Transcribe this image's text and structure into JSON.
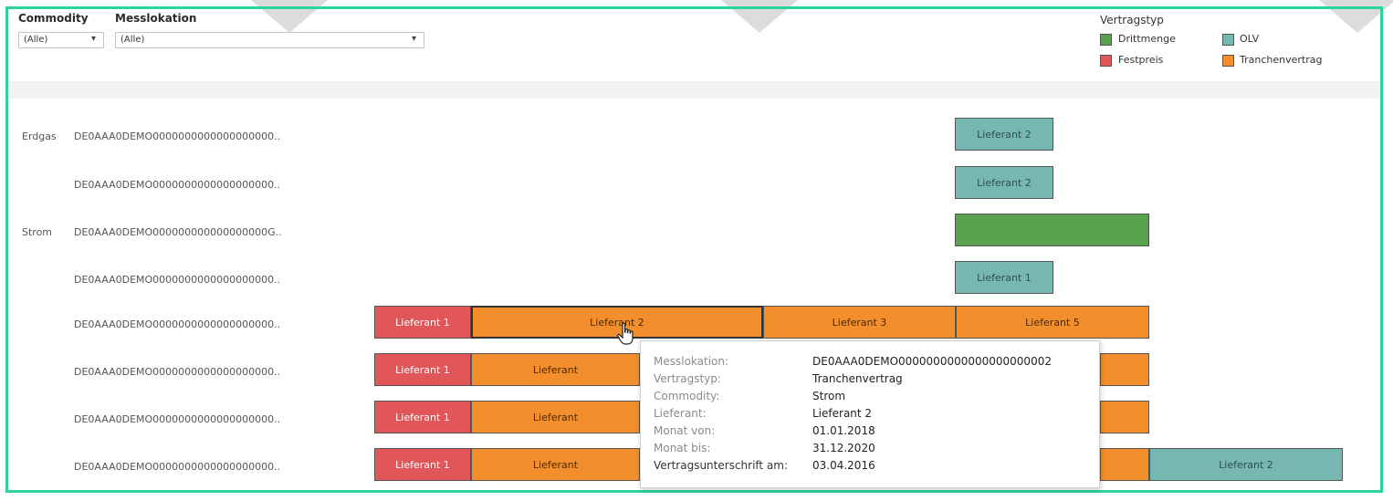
{
  "filters": {
    "commodity": {
      "label": "Commodity",
      "value": "(Alle)"
    },
    "messlokation": {
      "label": "Messlokation",
      "value": "(Alle)"
    }
  },
  "legend": {
    "title": "Vertragstyp",
    "items": [
      {
        "label": "Drittmenge",
        "color": "#59a14f"
      },
      {
        "label": "OLV",
        "color": "#76b7b2"
      },
      {
        "label": "Festpreis",
        "color": "#e15759"
      },
      {
        "label": "Tranchenvertrag",
        "color": "#f28e2b"
      }
    ]
  },
  "rows": [
    {
      "commodity": "Erdgas",
      "messlokation": "DE0AAA0DEMO0000000000000000000.."
    },
    {
      "commodity": "",
      "messlokation": "DE0AAA0DEMO0000000000000000000.."
    },
    {
      "commodity": "Strom",
      "messlokation": "DE0AAA0DEMO000000000000000000G.."
    },
    {
      "commodity": "",
      "messlokation": "DE0AAA0DEMO0000000000000000000.."
    },
    {
      "commodity": "",
      "messlokation": "DE0AAA0DEMO0000000000000000000.."
    },
    {
      "commodity": "",
      "messlokation": "DE0AAA0DEMO0000000000000000000.."
    },
    {
      "commodity": "",
      "messlokation": "DE0AAA0DEMO0000000000000000000.."
    },
    {
      "commodity": "",
      "messlokation": "DE0AAA0DEMO0000000000000000000.."
    }
  ],
  "chart_data": {
    "type": "gantt",
    "bars": [
      {
        "row": 0,
        "label": "Lieferant 2",
        "type": "OLV"
      },
      {
        "row": 1,
        "label": "Lieferant 2",
        "type": "OLV"
      },
      {
        "row": 2,
        "label": "",
        "type": "Drittmenge"
      },
      {
        "row": 3,
        "label": "Lieferant 1",
        "type": "OLV"
      },
      {
        "row": 4,
        "label": "Lieferant 1",
        "type": "Festpreis"
      },
      {
        "row": 4,
        "label": "Lieferant 2",
        "type": "Tranchenvertrag"
      },
      {
        "row": 4,
        "label": "Lieferant 3",
        "type": "Tranchenvertrag"
      },
      {
        "row": 4,
        "label": "Lieferant 5",
        "type": "Tranchenvertrag"
      },
      {
        "row": 5,
        "label": "Lieferant 1",
        "type": "Festpreis"
      },
      {
        "row": 5,
        "label": "Lieferant",
        "type": "Tranchenvertrag"
      },
      {
        "row": 5,
        "label": "",
        "type": "Tranchenvertrag"
      },
      {
        "row": 6,
        "label": "Lieferant 1",
        "type": "Festpreis"
      },
      {
        "row": 6,
        "label": "Lieferant",
        "type": "Tranchenvertrag"
      },
      {
        "row": 6,
        "label": "",
        "type": "Tranchenvertrag"
      },
      {
        "row": 7,
        "label": "Lieferant 1",
        "type": "Festpreis"
      },
      {
        "row": 7,
        "label": "Lieferant",
        "type": "Tranchenvertrag"
      },
      {
        "row": 7,
        "label": "",
        "type": "Tranchenvertrag"
      },
      {
        "row": 7,
        "label": "Lieferant 2",
        "type": "OLV"
      }
    ]
  },
  "tooltip": {
    "fields": [
      {
        "key": "Messlokation:",
        "value": "DE0AAA0DEMO0000000000000000000002"
      },
      {
        "key": "Vertragstyp:",
        "value": "Tranchenvertrag"
      },
      {
        "key": "Commodity:",
        "value": "Strom"
      },
      {
        "key": "Lieferant:",
        "value": "Lieferant 2"
      },
      {
        "key": "Monat von:",
        "value": "01.01.2018"
      },
      {
        "key": "Monat bis:",
        "value": "31.12.2020"
      },
      {
        "key": "Vertragsunterschrift am:",
        "value": "03.04.2016"
      }
    ]
  },
  "icons": {
    "cursor": "hand-pointer-icon"
  }
}
